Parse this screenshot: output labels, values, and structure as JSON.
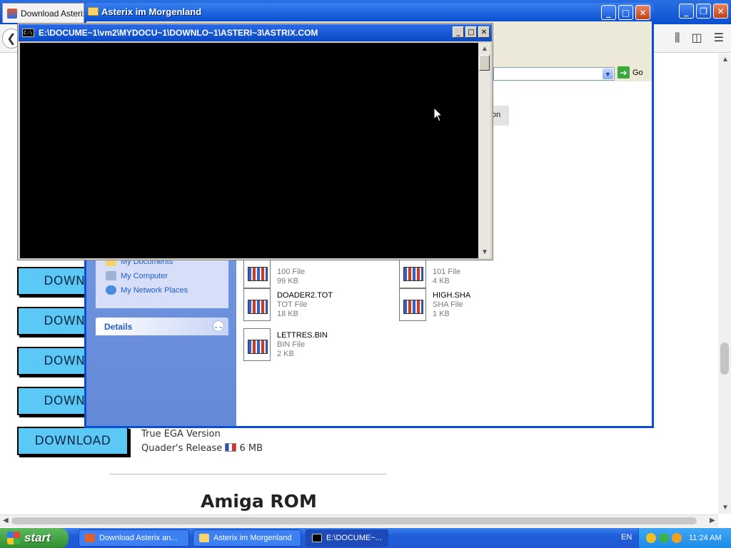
{
  "browser": {
    "tab_title": "Download Asterix",
    "downloads": [
      {
        "label": "DOWNLO"
      },
      {
        "label": "DOWNLO"
      },
      {
        "label": "DOWNLO"
      },
      {
        "label": "DOWNLO"
      },
      {
        "label": "DOWNLOAD",
        "desc1": "True EGA Version",
        "desc2": "Quader's Release",
        "size": "6 MB"
      }
    ],
    "heading": "Amiga ROM"
  },
  "explorer": {
    "title": "Asterix im Morgenland",
    "go_label": "Go",
    "partial_label": "on",
    "places": [
      "My Documents",
      "My Computer",
      "My Network Places"
    ],
    "details_label": "Details",
    "files": [
      {
        "name": "",
        "type": "100 File",
        "size": "99 KB"
      },
      {
        "name": "",
        "type": "101 File",
        "size": "4 KB"
      },
      {
        "name": "DOADER2.TOT",
        "type": "TOT File",
        "size": "18 KB"
      },
      {
        "name": "HIGH.SHA",
        "type": "SHA File",
        "size": "1 KB"
      },
      {
        "name": "LETTRES.BIN",
        "type": "BIN File",
        "size": "2 KB"
      }
    ]
  },
  "console": {
    "title": "E:\\DOCUME~1\\vm2\\MYDOCU~1\\DOWNLO~1\\ASTERI~3\\ASTRIX.COM"
  },
  "taskbar": {
    "start_label": "start",
    "tasks": [
      "Download Asterix an...",
      "Asterix im Morgenland",
      "E:\\DOCUME~..."
    ],
    "language": "EN",
    "time": "11:24 AM"
  }
}
